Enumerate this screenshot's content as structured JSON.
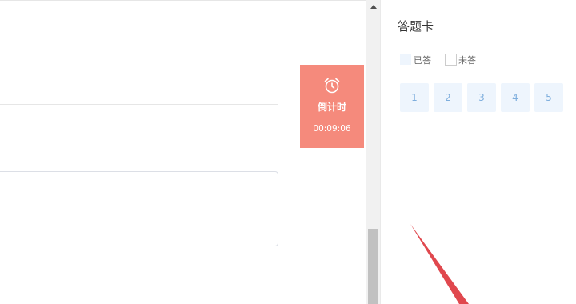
{
  "timer": {
    "icon": "alarm-clock-icon",
    "label": "倒计时",
    "time": "00:09:06",
    "color": "#f58a7c"
  },
  "answer_card": {
    "title": "答题卡",
    "legend": {
      "answered": "已答",
      "unanswered": "未答"
    },
    "questions": [
      "1",
      "2",
      "3",
      "4",
      "5"
    ],
    "answered_color": "#eef5fd"
  },
  "annotation": {
    "arrow_color": "#e0484e"
  }
}
